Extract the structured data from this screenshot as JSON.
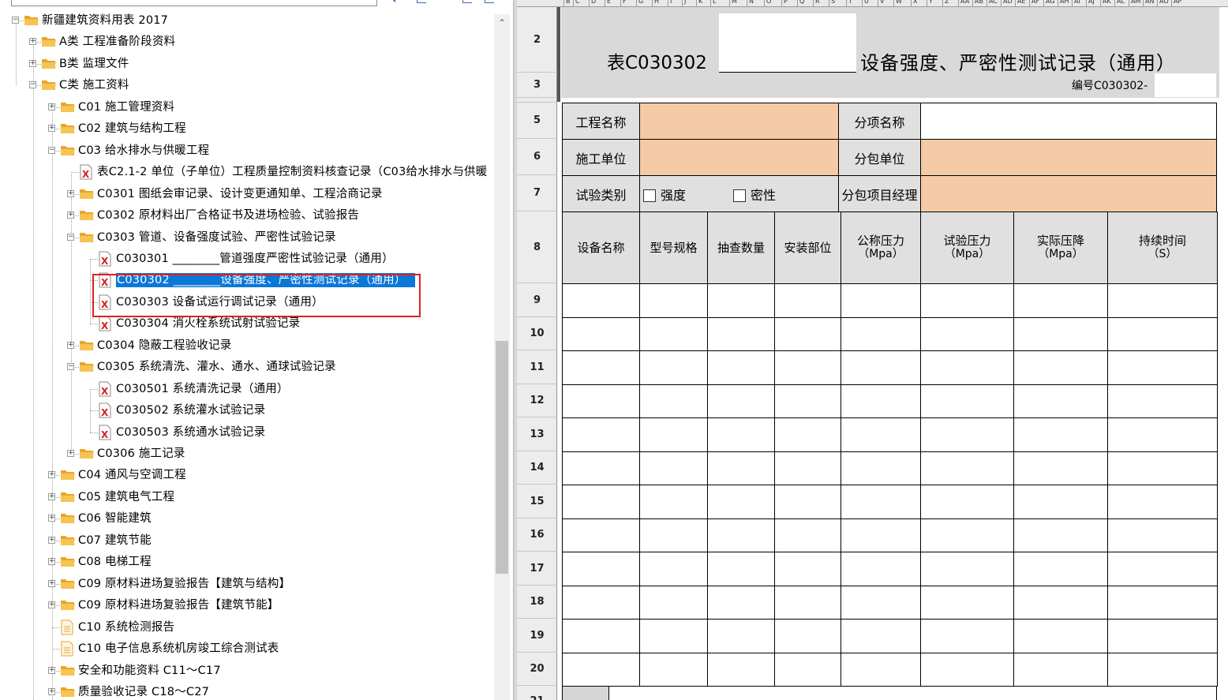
{
  "tree": {
    "items": [
      {
        "label": "新疆建筑资料用表 2017"
      },
      {
        "label": "A类 工程准备阶段资料"
      },
      {
        "label": "B类 监理文件"
      },
      {
        "label": "C类 施工资料"
      },
      {
        "label": "C01 施工管理资料"
      },
      {
        "label": "C02 建筑与结构工程"
      },
      {
        "label": "C03 给水排水与供暖工程"
      },
      {
        "label": "表C2.1-2 单位（子单位）工程质量控制资料核查记录（C03给水排水与供暖"
      },
      {
        "label": "C0301 图纸会审记录、设计变更通知单、工程洽商记录"
      },
      {
        "label": "C0302 原材料出厂合格证书及进场检验、试验报告"
      },
      {
        "label": "C0303 管道、设备强度试验、严密性试验记录"
      },
      {
        "label": "C030301 ________管道强度严密性试验记录（通用）"
      },
      {
        "label": "C030302 ________设备强度、严密性测试记录（通用）"
      },
      {
        "label": "C030303 设备试运行调试记录（通用）"
      },
      {
        "label": "C030304 消火栓系统试射试验记录"
      },
      {
        "label": "C0304 隐蔽工程验收记录"
      },
      {
        "label": "C0305 系统清洗、灌水、通水、通球试验记录"
      },
      {
        "label": "C030501 系统清洗记录（通用）"
      },
      {
        "label": "C030502 系统灌水试验记录"
      },
      {
        "label": "C030503 系统通水试验记录"
      },
      {
        "label": "C0306 施工记录"
      },
      {
        "label": "C04 通风与空调工程"
      },
      {
        "label": "C05 建筑电气工程"
      },
      {
        "label": "C06 智能建筑"
      },
      {
        "label": "C07 建筑节能"
      },
      {
        "label": "C08 电梯工程"
      },
      {
        "label": "C09 原材料进场复验报告【建筑与结构】"
      },
      {
        "label": "C09 原材料进场复验报告【建筑节能】"
      },
      {
        "label": "C10 系统检测报告"
      },
      {
        "label": "C10 电子信息系统机房竣工综合测试表"
      },
      {
        "label": "安全和功能资料 C11～C17"
      },
      {
        "label": "质量验收记录 C18～C27"
      }
    ],
    "selected_index": 12,
    "scroll_up_glyph": "⌃"
  },
  "sheet": {
    "col_letters": [
      "B",
      "C",
      "D",
      "E",
      "F",
      "G",
      "H",
      "I",
      "J",
      "K",
      "L",
      "M",
      "N",
      "O",
      "P",
      "Q",
      "R",
      "S",
      "T",
      "U",
      "V",
      "W",
      "X",
      "Y",
      "Z",
      "AA",
      "AB",
      "AC",
      "AD",
      "AE",
      "AF",
      "AG",
      "AH",
      "AI",
      "AJ",
      "AK",
      "AL",
      "AM",
      "AN",
      "AO",
      "AP"
    ],
    "row_numbers": {
      "r2": "2",
      "r3": "3",
      "r5": "5",
      "r6": "6",
      "r7": "7",
      "r8": "8",
      "r9": "9",
      "r10": "10",
      "r11": "11",
      "r12": "12",
      "r13": "13",
      "r14": "14",
      "r15": "15",
      "r16": "16",
      "r17": "17",
      "r18": "18",
      "r19": "19",
      "r20": "20",
      "r21": "21"
    },
    "form_code": "表C030302",
    "form_title": "设备强度、严密性测试记录（通用）",
    "serial_label": "编号C030302-",
    "labels": {
      "project_name": "工程名称",
      "sub_item_name": "分项名称",
      "construction_unit": "施工单位",
      "subcontract_unit": "分包单位",
      "test_type": "试验类别",
      "strength": "强度",
      "tightness": "密性",
      "subcontract_manager": "分包项目经理"
    },
    "columns": [
      {
        "line1": "设备名称",
        "line2": ""
      },
      {
        "line1": "型号规格",
        "line2": ""
      },
      {
        "line1": "抽查数量",
        "line2": ""
      },
      {
        "line1": "安装部位",
        "line2": ""
      },
      {
        "line1": "公称压力",
        "line2": "（Mpa）"
      },
      {
        "line1": "试验压力",
        "line2": "（Mpa）"
      },
      {
        "line1": "实际压降",
        "line2": "（Mpa）"
      },
      {
        "line1": "持续时间",
        "line2": "（S）"
      }
    ]
  },
  "colors": {
    "selection": "#0b78d7",
    "highlight_box": "#e02020",
    "peach_fill": "#f5cba7",
    "folder": "#f2b233"
  }
}
